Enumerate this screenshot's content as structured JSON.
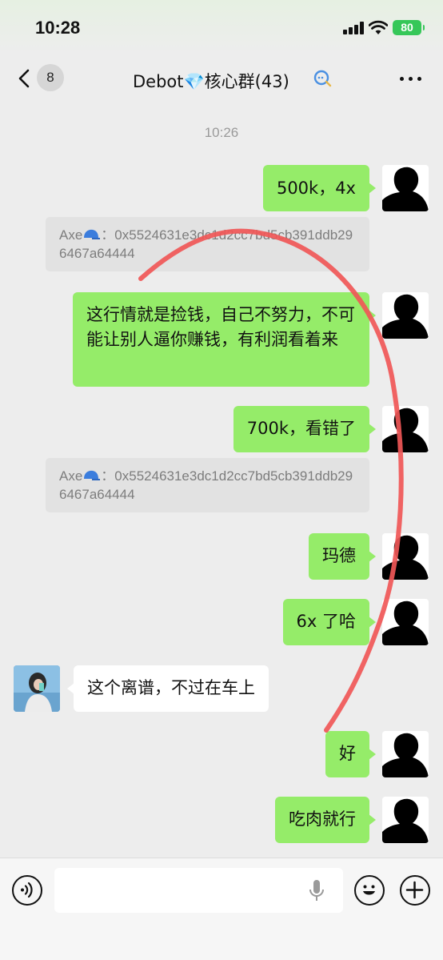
{
  "status": {
    "time": "10:28",
    "battery": "80"
  },
  "nav": {
    "back_count": "8",
    "title": "Debot💎核心群(43)"
  },
  "timestamp": "10:26",
  "messages": {
    "m1": "500k，4x",
    "q1_name": "Axe",
    "q1_text": "：0x5524631e3dc1d2cc7bd5cb391ddb296467a64444",
    "m2": "这行情就是捡钱，自己不努力，不可能让别人逼你赚钱，有利润看着来",
    "m3": "700k，看错了",
    "q2_name": "Axe",
    "q2_text": "：0x5524631e3dc1d2cc7bd5cb391ddb296467a64444",
    "m4": "玛德",
    "m5": "6x 了哈",
    "m6": "这个离谱，不过在车上",
    "m7": "好",
    "m8": "吃肉就行"
  },
  "icons": {
    "back": "chevron-left-icon",
    "more": "more-icon",
    "voice": "voice-icon",
    "emoji": "emoji-icon",
    "plus": "plus-icon",
    "mic": "mic-icon",
    "cap": "blue-cap-emoji"
  },
  "colors": {
    "mine_bubble": "#95ec69",
    "annotation": "#f05757"
  }
}
